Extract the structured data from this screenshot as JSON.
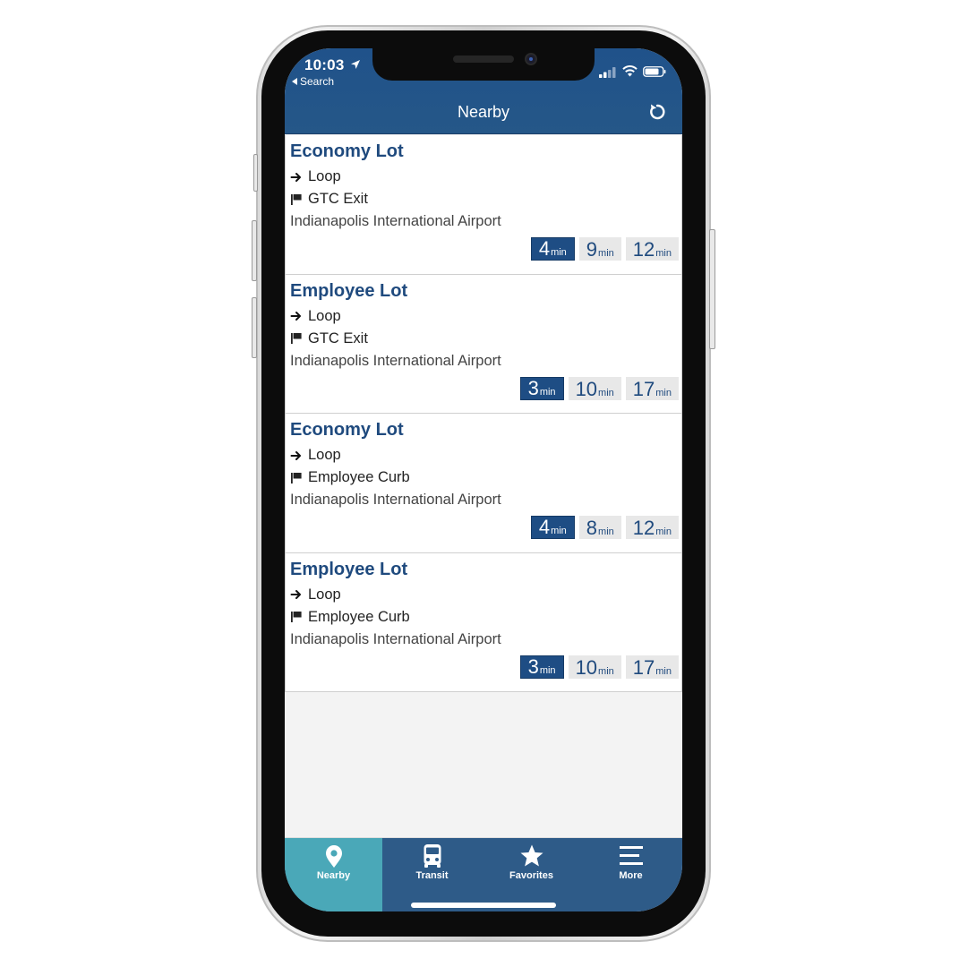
{
  "status_bar": {
    "time": "10:03",
    "back_label": "Search"
  },
  "header": {
    "title": "Nearby",
    "refresh_icon": "refresh-icon"
  },
  "stops": [
    {
      "name": "Economy Lot",
      "route": "Loop",
      "destination": "GTC Exit",
      "place": "Indianapolis International Airport",
      "arrivals": [
        {
          "value": "4",
          "unit": "min"
        },
        {
          "value": "9",
          "unit": "min"
        },
        {
          "value": "12",
          "unit": "min"
        }
      ]
    },
    {
      "name": "Employee Lot",
      "route": "Loop",
      "destination": "GTC Exit",
      "place": "Indianapolis International Airport",
      "arrivals": [
        {
          "value": "3",
          "unit": "min"
        },
        {
          "value": "10",
          "unit": "min"
        },
        {
          "value": "17",
          "unit": "min"
        }
      ]
    },
    {
      "name": "Economy Lot",
      "route": "Loop",
      "destination": "Employee Curb",
      "place": "Indianapolis International Airport",
      "arrivals": [
        {
          "value": "4",
          "unit": "min"
        },
        {
          "value": "8",
          "unit": "min"
        },
        {
          "value": "12",
          "unit": "min"
        }
      ]
    },
    {
      "name": "Employee Lot",
      "route": "Loop",
      "destination": "Employee Curb",
      "place": "Indianapolis International Airport",
      "arrivals": [
        {
          "value": "3",
          "unit": "min"
        },
        {
          "value": "10",
          "unit": "min"
        },
        {
          "value": "17",
          "unit": "min"
        }
      ]
    }
  ],
  "tabs": [
    {
      "label": "Nearby",
      "icon": "map-pin-icon",
      "active": true
    },
    {
      "label": "Transit",
      "icon": "bus-icon",
      "active": false
    },
    {
      "label": "Favorites",
      "icon": "star-icon",
      "active": false
    },
    {
      "label": "More",
      "icon": "menu-icon",
      "active": false
    }
  ],
  "colors": {
    "header_bg": "#255788",
    "accent_active_tab": "#4aa8b8",
    "tabbar_bg": "#2e5b88",
    "title_text": "#1f4a7e",
    "primary_chip": "#1e4d84",
    "secondary_chip": "#e8e8e8"
  }
}
